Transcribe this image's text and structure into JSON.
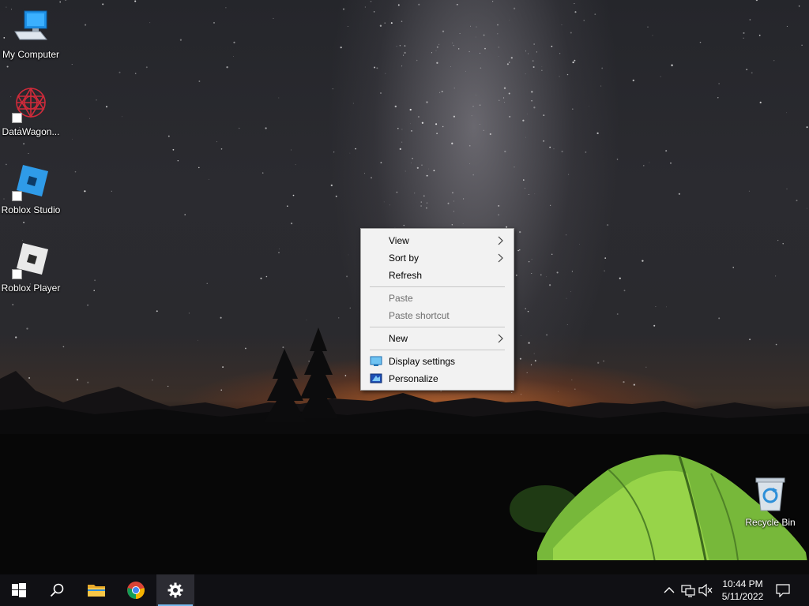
{
  "desktop": {
    "icons": [
      {
        "label": "My Computer",
        "icon": "computer-icon"
      },
      {
        "label": "DataWagon...",
        "icon": "datawagon-icon"
      },
      {
        "label": "Roblox Studio",
        "icon": "roblox-studio-icon"
      },
      {
        "label": "Roblox Player",
        "icon": "roblox-player-icon"
      },
      {
        "label": "Recycle Bin",
        "icon": "recycle-bin-icon"
      }
    ]
  },
  "context_menu": {
    "items": [
      {
        "label": "View",
        "submenu": true,
        "disabled": false
      },
      {
        "label": "Sort by",
        "submenu": true,
        "disabled": false
      },
      {
        "label": "Refresh",
        "submenu": false,
        "disabled": false
      },
      {
        "label": "Paste",
        "submenu": false,
        "disabled": true
      },
      {
        "label": "Paste shortcut",
        "submenu": false,
        "disabled": true
      },
      {
        "label": "New",
        "submenu": true,
        "disabled": false
      },
      {
        "label": "Display settings",
        "icon": "display-icon",
        "disabled": false
      },
      {
        "label": "Personalize",
        "icon": "personalize-icon",
        "disabled": false
      }
    ]
  },
  "taskbar": {
    "buttons": [
      "start-icon",
      "search-icon",
      "file-explorer-icon",
      "chrome-icon",
      "settings-icon"
    ],
    "active": "settings-icon",
    "tray": [
      "chevron-up-icon",
      "network-icon",
      "volume-muted-icon",
      "notification-icon"
    ],
    "clock": {
      "time": "10:44 PM",
      "date": "5/11/2022"
    }
  },
  "colors": {
    "menu_bg": "#f2f2f2",
    "taskbar_bg": "#101014",
    "accent": "#76b9ed",
    "disabled_text": "#6d6d6d"
  }
}
